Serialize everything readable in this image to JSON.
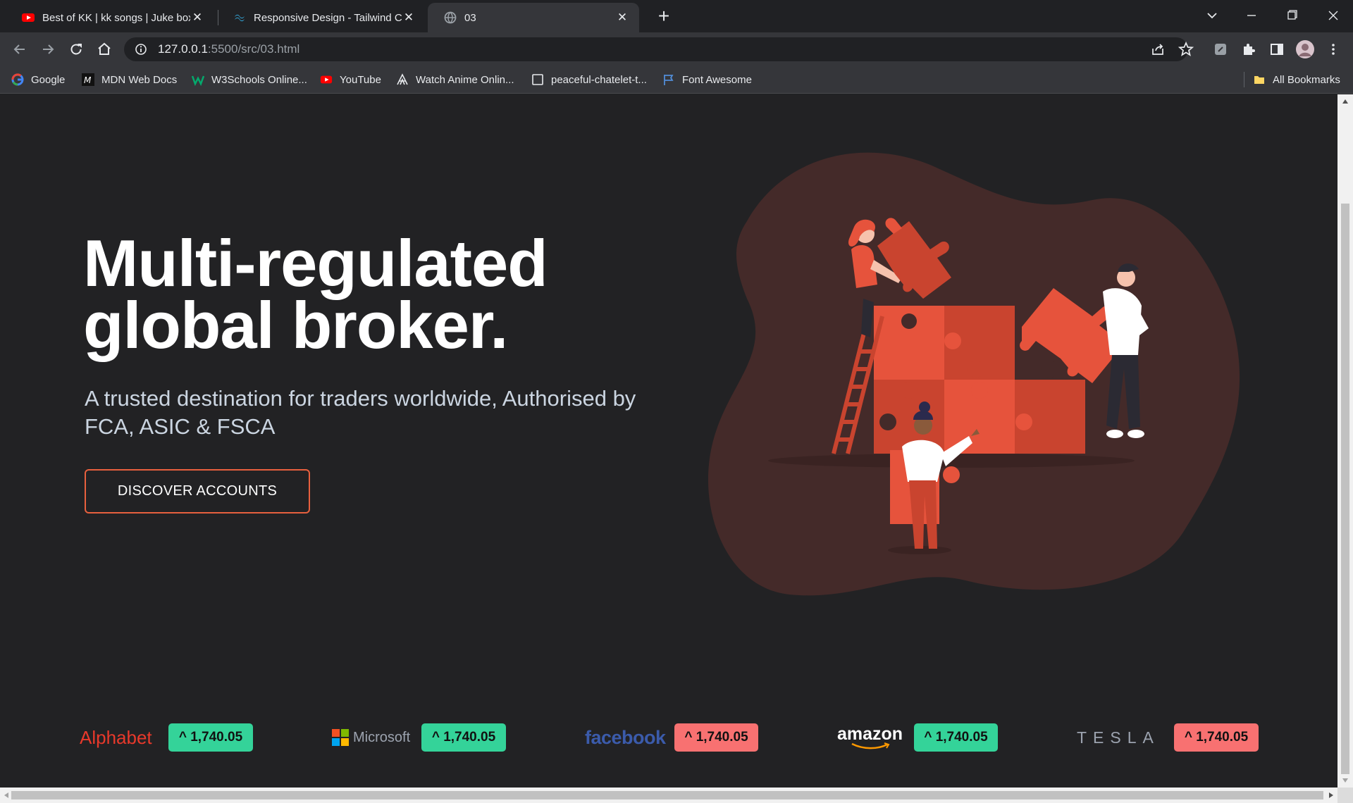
{
  "browser": {
    "tabs": [
      {
        "title": "Best of KK | kk songs | Juke box |",
        "icon": "youtube-icon",
        "active": false
      },
      {
        "title": "Responsive Design - Tailwind CSS",
        "icon": "tailwind-icon",
        "active": false
      },
      {
        "title": "03",
        "icon": "globe-icon",
        "active": true
      }
    ],
    "new_tab_label": "+",
    "url_host": "127.0.0.1",
    "url_rest": ":5500/src/03.html",
    "bookmarks": [
      {
        "label": "Google",
        "icon": "google-icon"
      },
      {
        "label": "MDN Web Docs",
        "icon": "mdn-icon"
      },
      {
        "label": "W3Schools Online...",
        "icon": "w3schools-icon"
      },
      {
        "label": "YouTube",
        "icon": "youtube-icon"
      },
      {
        "label": "Watch Anime Onlin...",
        "icon": "anime-icon"
      },
      {
        "label": "peaceful-chatelet-t...",
        "icon": "page-icon"
      },
      {
        "label": "Font Awesome",
        "icon": "flag-icon"
      }
    ],
    "all_bookmarks_label": "All Bookmarks"
  },
  "hero": {
    "title_line1": "Multi-regulated",
    "title_line2": "global broker.",
    "subtitle": "A trusted destination for traders worldwide, Authorised by FCA, ASIC & FSCA",
    "cta_label": "DISCOVER ACCOUNTS"
  },
  "tickers": [
    {
      "company": "Alphabet",
      "value": "^ 1,740.05",
      "trend": "up"
    },
    {
      "company": "Microsoft",
      "value": "^ 1,740.05",
      "trend": "up"
    },
    {
      "company": "facebook",
      "value": "^ 1,740.05",
      "trend": "down"
    },
    {
      "company": "amazon",
      "value": "^ 1,740.05",
      "trend": "up"
    },
    {
      "company": "TESLA",
      "value": "^ 1,740.05",
      "trend": "down"
    }
  ],
  "colors": {
    "accent": "#e8603e",
    "page_bg": "#222224",
    "blob": "#442a29",
    "puzzle": "#e6533c",
    "ticker_up": "#34d399",
    "ticker_down": "#f87171"
  }
}
